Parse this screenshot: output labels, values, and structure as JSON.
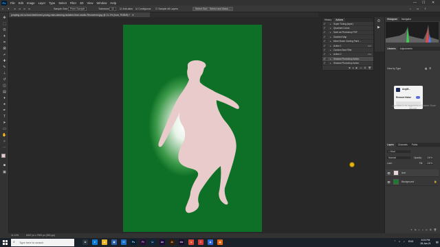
{
  "app": {
    "logo_text": "Ps",
    "menus": [
      "File",
      "Edit",
      "Image",
      "Layer",
      "Type",
      "Select",
      "Filter",
      "3D",
      "View",
      "Window",
      "Help"
    ],
    "window_controls": [
      "—",
      "☐",
      "✕"
    ]
  },
  "options_bar": {
    "sample_size_label": "Sample Size:",
    "sample_size_value": "Point Sample",
    "tolerance_label": "Tolerance:",
    "tolerance_value": "32",
    "anti_alias_label": "Anti-alias",
    "contiguous_label": "Contiguous",
    "sample_all_layers_label": "Sample All Layers",
    "select_subject_label": "Select Subject",
    "select_mask_label": "Select and Mask..."
  },
  "document_tab": {
    "title": "jumping-old-school-fashioned-young-man-dancing-isolated-blue-studio-Recovered.jpg @ 11.1% (Icon, RGB/8) *"
  },
  "status_bar": {
    "zoom": "11.11%",
    "doc_info": "6347 px x 7900 px (300 ppi)"
  },
  "panels": {
    "actions_tabs": [
      "History",
      "Actions"
    ],
    "actions": [
      {
        "label": "Super Toning (layer)",
        "fkey": "",
        "selected": false
      },
      {
        "label": "Quadrant Colors",
        "fkey": "",
        "selected": false
      },
      {
        "label": "Save as Photoshop PDF",
        "fkey": "",
        "selected": false
      },
      {
        "label": "Gradient Map",
        "fkey": "",
        "selected": false
      },
      {
        "label": "Mixer Brush Cloning Paint ...",
        "fkey": "",
        "selected": false
      },
      {
        "label": "Action 1",
        "fkey": "F12",
        "selected": false
      },
      {
        "label": "Camera Raw Filter",
        "fkey": "",
        "selected": false
      },
      {
        "label": "Action 2",
        "fkey": "F11",
        "selected": false
      },
      {
        "label": "Shadow Photoshop Action",
        "fkey": "",
        "selected": true
      },
      {
        "label": "Shadow Photoshop Action",
        "fkey": "",
        "selected": false
      }
    ],
    "histogram_tabs": [
      "Histogram",
      "Navigator"
    ],
    "libraries_tabs": [
      "Libraries",
      "Adjustments"
    ],
    "libraries_view": "View by Type",
    "library_card": {
      "title": "AnyM...",
      "subtitle": "Remove Noise",
      "note": "...you need to be logged into a Creative Cloud account."
    },
    "layers_tabs": [
      "Layers",
      "Channels",
      "Paths"
    ],
    "layers_filter": "Kind",
    "blend_mode": "Normal",
    "opacity_label": "Opacity:",
    "opacity_value": "100%",
    "fill_label": "Fill:",
    "fill_value": "100%",
    "lock_label": "Lock:",
    "layers": [
      {
        "name": "lcon",
        "italic": false,
        "thumb": "#e9d6d6"
      },
      {
        "name": "Background",
        "italic": true,
        "thumb": "#1a7a2e"
      }
    ]
  },
  "taskbar": {
    "search_placeholder": "Type here to search",
    "apps": [
      {
        "name": "task-view",
        "label": "⧉",
        "color": "#2b3540"
      },
      {
        "name": "edge",
        "label": "e",
        "color": "#0e7ad4"
      },
      {
        "name": "file-explorer",
        "label": "▰",
        "color": "#e8b62b"
      },
      {
        "name": "store",
        "label": "▣",
        "color": "#2b5fa8"
      },
      {
        "name": "mail",
        "label": "✉",
        "color": "#1e6fc4"
      },
      {
        "name": "photoshop",
        "label": "Ps",
        "color": "#001e36"
      },
      {
        "name": "premiere",
        "label": "Pr",
        "color": "#2a0a3a"
      },
      {
        "name": "lightroom",
        "label": "Lr",
        "color": "#0a2540"
      },
      {
        "name": "after-effects",
        "label": "Ae",
        "color": "#1e0a3a"
      },
      {
        "name": "illustrator",
        "label": "Ai",
        "color": "#3a1a00"
      },
      {
        "name": "media-encoder",
        "label": "Me",
        "color": "#1a0a30"
      },
      {
        "name": "chrome",
        "label": "●",
        "color": "#dd4b39"
      },
      {
        "name": "app-c",
        "label": "C",
        "color": "#d23c3c"
      },
      {
        "name": "app-blue",
        "label": "◆",
        "color": "#2d6ad6"
      },
      {
        "name": "app-orange",
        "label": "◉",
        "color": "#e06a1a"
      }
    ],
    "time": "5:23 PM",
    "date": "28-Jan-21",
    "language": "ENG"
  },
  "colors": {
    "document_green": "#0c6e22",
    "silhouette": "#e9cbcb",
    "accent_blue": "#31a8ff"
  }
}
